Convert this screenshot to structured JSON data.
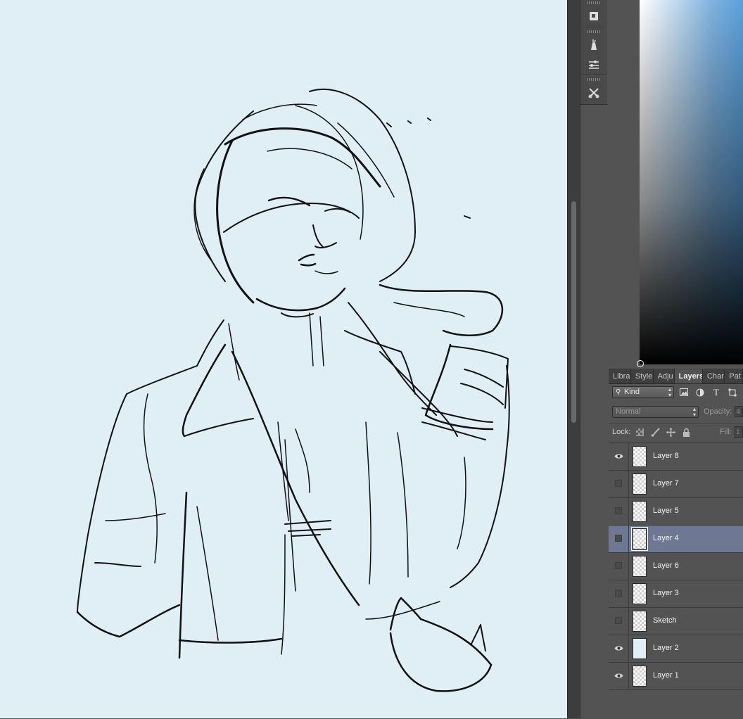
{
  "panel": {
    "tabs": [
      "Libra",
      "Style",
      "Adju",
      "Layers",
      "Char",
      "Pat"
    ],
    "active_tab": "Layers",
    "filter": {
      "kind_label": "Kind",
      "filter_icons": [
        "image-filter-icon",
        "adjustment-filter-icon",
        "type-filter-icon",
        "shape-filter-icon"
      ]
    },
    "blend": {
      "mode": "Normal",
      "opacity_label": "Opacity:",
      "opacity_value": "4"
    },
    "lock": {
      "label": "Lock:",
      "fill_label": "Fill:",
      "fill_value": "1"
    },
    "layers": [
      {
        "name": "Layer 8",
        "visible": true
      },
      {
        "name": "Layer 7",
        "visible": false
      },
      {
        "name": "Layer 5",
        "visible": false
      },
      {
        "name": "Layer 4",
        "visible": false,
        "selected": true
      },
      {
        "name": "Layer 6",
        "visible": false
      },
      {
        "name": "Layer 3",
        "visible": false
      },
      {
        "name": "Sketch",
        "visible": false
      },
      {
        "name": "Layer 2",
        "visible": true,
        "solid": true
      },
      {
        "name": "Layer 1",
        "visible": true
      }
    ]
  },
  "colors": {
    "canvas_bg": "#e0eef5",
    "ui_panel": "#535353",
    "selected_row": "#6e7892",
    "picker_hue": "#5aa0dd"
  },
  "toolstrip": [
    "3d-tool-icon",
    "brush-presets-icon",
    "tool-presets-icon",
    "clone-source-icon"
  ]
}
